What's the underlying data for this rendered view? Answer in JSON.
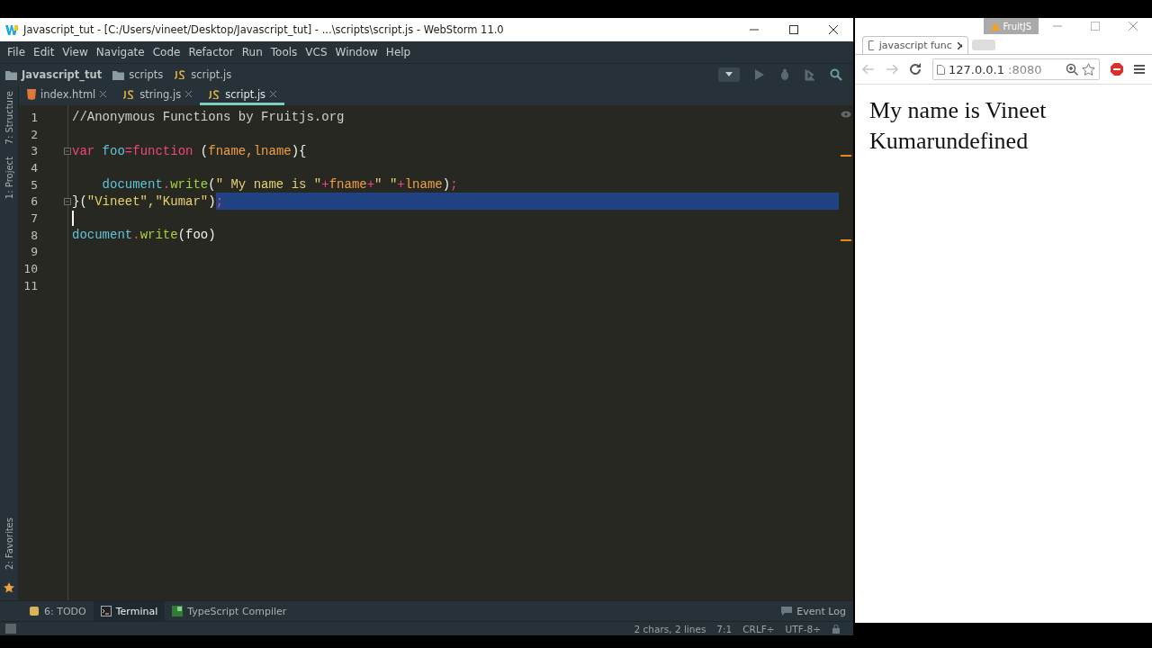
{
  "ide": {
    "title": "Javascript_tut - [C:/Users/vineet/Desktop/Javascript_tut] - ...\\scripts\\script.js - WebStorm 11.0",
    "menu": [
      "File",
      "Edit",
      "View",
      "Navigate",
      "Code",
      "Refactor",
      "Run",
      "Tools",
      "VCS",
      "Window",
      "Help"
    ],
    "breadcrumbs": [
      {
        "label": "Javascript_tut",
        "kind": "project"
      },
      {
        "label": "scripts",
        "kind": "folder"
      },
      {
        "label": "script.js",
        "kind": "js"
      }
    ],
    "tabs": [
      {
        "label": "index.html",
        "kind": "html",
        "selected": false
      },
      {
        "label": "string.js",
        "kind": "js",
        "selected": false
      },
      {
        "label": "script.js",
        "kind": "js",
        "selected": true
      }
    ],
    "side_tabs_top": [
      "7: Structure",
      "1: Project"
    ],
    "side_tabs_bottom": [
      "2: Favorites"
    ],
    "lines": [
      {
        "number": "1",
        "tokens": [
          {
            "kind": "comment",
            "text": "//Anonymous Functions by Fruitjs.org"
          }
        ]
      },
      {
        "number": "2"
      },
      {
        "number": "3",
        "fold": true,
        "tokens": [
          {
            "kind": "keyword",
            "text": "var"
          },
          {
            "kind": "ident",
            "text": " foo"
          },
          {
            "kind": "keyword",
            "text": "=function"
          },
          {
            "kind": "plain",
            "text": " ("
          },
          {
            "kind": "param",
            "text": "fname,lname"
          },
          {
            "kind": "plain",
            "text": "){"
          }
        ]
      },
      {
        "number": "4"
      },
      {
        "number": "5",
        "indented": true,
        "tokens": [
          {
            "kind": "ident",
            "text": "document"
          },
          {
            "kind": "keyword",
            "text": "."
          },
          {
            "kind": "method",
            "text": "write"
          },
          {
            "kind": "plain",
            "text": "("
          },
          {
            "kind": "string",
            "text": "\" My name is \""
          },
          {
            "kind": "keyword",
            "text": "+"
          },
          {
            "kind": "param",
            "text": "fname"
          },
          {
            "kind": "keyword",
            "text": "+"
          },
          {
            "kind": "string",
            "text": "\" \""
          },
          {
            "kind": "keyword",
            "text": "+"
          },
          {
            "kind": "param",
            "text": "lname"
          },
          {
            "kind": "plain",
            "text": ")"
          },
          {
            "kind": "keyword",
            "text": ";"
          }
        ]
      },
      {
        "number": "6",
        "fold": true,
        "tokens": [
          {
            "kind": "plain",
            "text": "}("
          },
          {
            "kind": "string",
            "text": "\"Vineet\",\"Kumar\""
          },
          {
            "kind": "plain",
            "text": ")"
          }
        ],
        "selected_tokens": [
          {
            "kind": "keyword",
            "text": ";"
          }
        ]
      },
      {
        "number": "7",
        "caret": true
      },
      {
        "number": "8",
        "tokens": [
          {
            "kind": "ident",
            "text": "document"
          },
          {
            "kind": "keyword",
            "text": "."
          },
          {
            "kind": "method",
            "text": "write"
          },
          {
            "kind": "plain",
            "text": "(foo)"
          }
        ]
      },
      {
        "number": "9"
      },
      {
        "number": "10"
      },
      {
        "number": "11"
      }
    ],
    "tool_tabs": [
      {
        "label": "6: TODO",
        "kind": "todo",
        "selected": false
      },
      {
        "label": "Terminal",
        "kind": "terminal",
        "selected": true
      },
      {
        "label": "TypeScript Compiler",
        "kind": "ts",
        "selected": false
      }
    ],
    "event_log": "Event Log",
    "status": [
      "2 chars, 2 lines",
      "7:1",
      "CRLF÷",
      "UTF-8÷"
    ]
  },
  "browser": {
    "badge": "FruitJS",
    "tab": "javascript func",
    "url_host": "127.0.0.1",
    "url_port": ":8080",
    "content": "My name is Vineet Kumarundefined"
  }
}
